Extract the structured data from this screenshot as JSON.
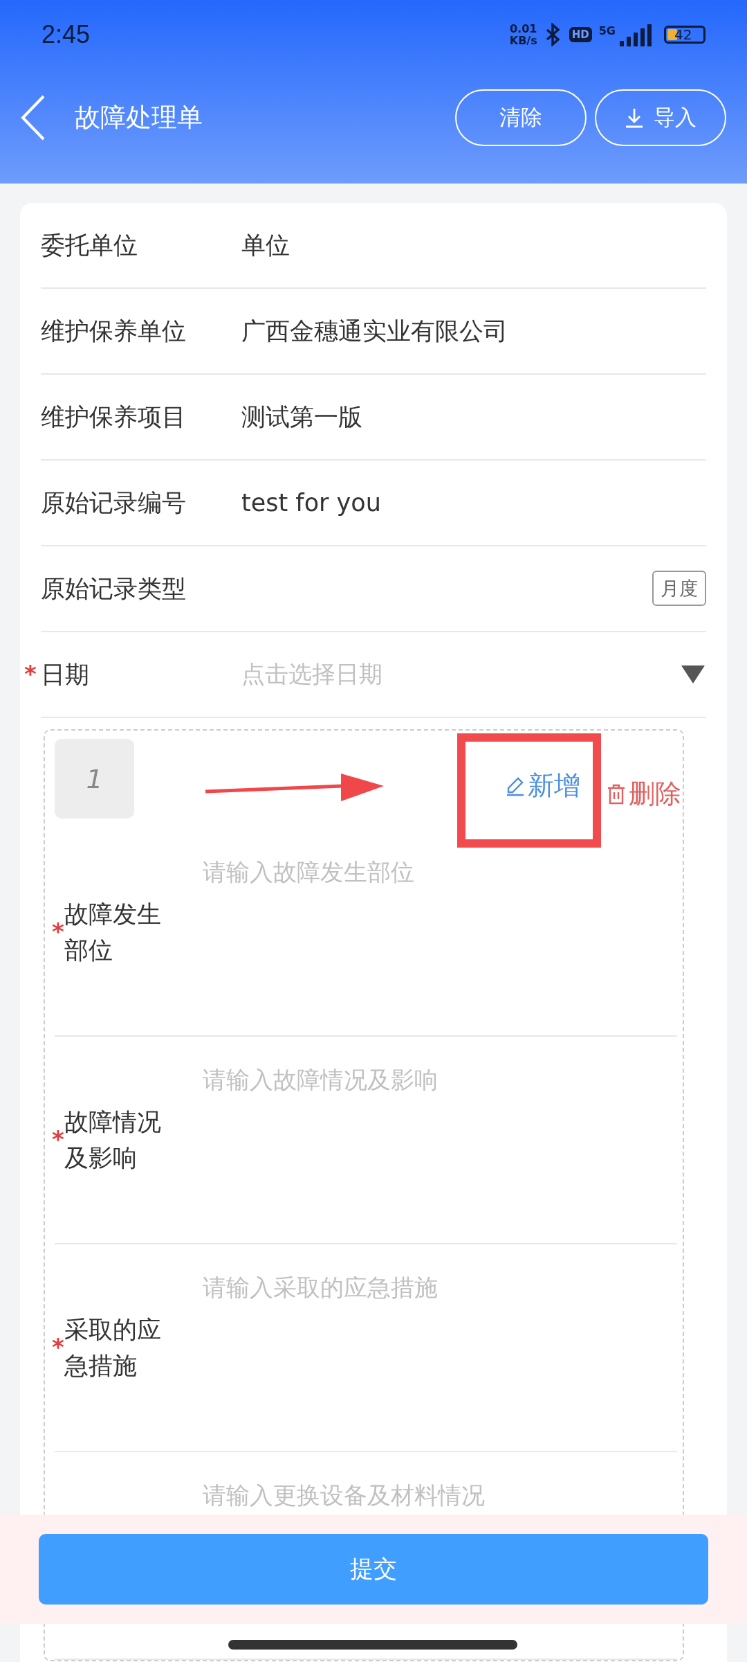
{
  "status_bar": {
    "time": "2:45",
    "net_speed_value": "0.01",
    "net_speed_unit": "KB/s",
    "hd_badge": "HD",
    "network": "5G",
    "battery": "42"
  },
  "required_mark": "*",
  "header": {
    "title": "故障处理单",
    "buttons": [
      {
        "label": "清除",
        "kind": "plain"
      },
      {
        "label": "导入",
        "kind": "download"
      }
    ]
  },
  "form_rows": [
    {
      "label": "委托单位",
      "kind": "text",
      "value": "单位",
      "required": false
    },
    {
      "label": "维护保养单位",
      "kind": "text",
      "value": "广西金穗通实业有限公司",
      "required": false
    },
    {
      "label": "维护保养项目",
      "kind": "text",
      "value": "测试第一版",
      "required": false
    },
    {
      "label": "原始记录编号",
      "kind": "text",
      "value": "test for you",
      "required": false
    },
    {
      "label": "原始记录类型",
      "kind": "tag",
      "value": "月度",
      "required": false
    },
    {
      "label": "日期",
      "kind": "select",
      "placeholder": "点击选择日期",
      "required": true
    }
  ],
  "entry": {
    "index": "1",
    "actions": [
      {
        "label": "新增",
        "kind": "add"
      },
      {
        "label": "删除",
        "kind": "delete"
      }
    ],
    "fields": [
      {
        "label": "故障发生部位",
        "placeholder": "请输入故障发生部位",
        "required": true
      },
      {
        "label": "故障情况及影响",
        "placeholder": "请输入故障情况及影响",
        "required": true
      },
      {
        "label": "采取的应急措施",
        "placeholder": "请输入采取的应急措施",
        "required": true
      },
      {
        "placeholder": "请输入更换设备及材料情况",
        "required": false
      }
    ]
  },
  "submit": "提交"
}
